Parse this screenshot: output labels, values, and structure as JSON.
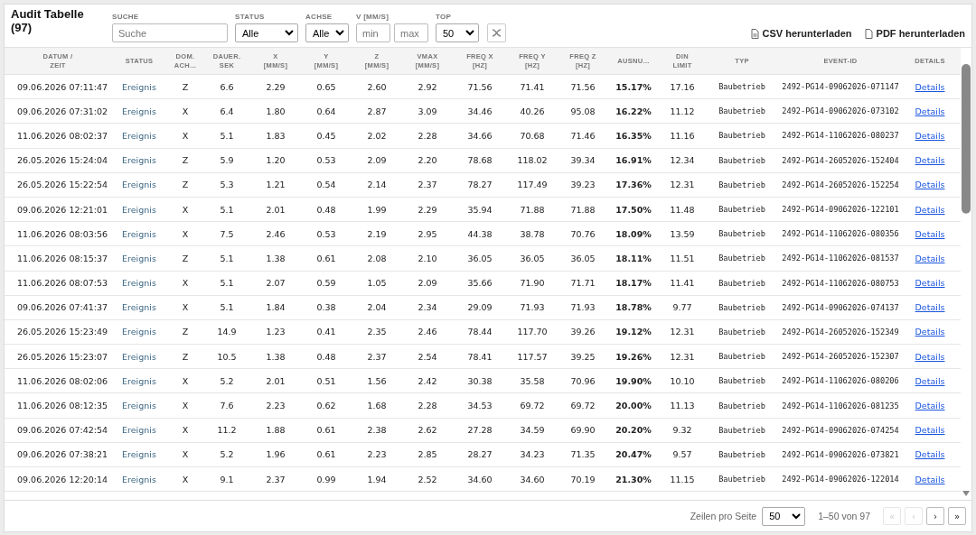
{
  "title": "Audit Tabelle (97)",
  "filters": [
    {
      "kind": "text",
      "label": "SUCHE",
      "placeholder": "Suche"
    },
    {
      "kind": "select",
      "label": "STATUS",
      "value": "Alle"
    },
    {
      "kind": "select",
      "label": "ACHSE",
      "value": "Alle"
    },
    {
      "kind": "range",
      "label": "V [MM/S]",
      "min_placeholder": "min",
      "max_placeholder": "max"
    },
    {
      "kind": "select",
      "label": "TOP",
      "value": "50"
    }
  ],
  "downloads": [
    {
      "kind": "csv",
      "label": "CSV herunterladen"
    },
    {
      "kind": "pdf",
      "label": "PDF herunterladen"
    }
  ],
  "table": {
    "columns": [
      {
        "lines": [
          "DATUM /",
          "ZEIT"
        ],
        "kind": "date"
      },
      {
        "lines": [
          "STATUS"
        ],
        "kind": "status"
      },
      {
        "lines": [
          "DOM.",
          "ACH..."
        ],
        "kind": "num"
      },
      {
        "lines": [
          "DAUER.",
          "SEK"
        ],
        "kind": "num"
      },
      {
        "lines": [
          "X",
          "[MM/S]"
        ],
        "kind": "num"
      },
      {
        "lines": [
          "Y",
          "[MM/S]"
        ],
        "kind": "num"
      },
      {
        "lines": [
          "Z",
          "[MM/S]"
        ],
        "kind": "num"
      },
      {
        "lines": [
          "VMAX",
          "[MM/S]"
        ],
        "kind": "num"
      },
      {
        "lines": [
          "FREQ X",
          "[HZ]"
        ],
        "kind": "num"
      },
      {
        "lines": [
          "FREQ Y",
          "[HZ]"
        ],
        "kind": "num"
      },
      {
        "lines": [
          "FREQ Z",
          "[HZ]"
        ],
        "kind": "num"
      },
      {
        "lines": [
          "AUSNU..."
        ],
        "kind": "bold"
      },
      {
        "lines": [
          "DIN",
          "LIMIT"
        ],
        "kind": "num"
      },
      {
        "lines": [
          "TYP"
        ],
        "kind": "mono"
      },
      {
        "lines": [
          "EVENT-ID"
        ],
        "kind": "mono"
      },
      {
        "lines": [
          "DETAILS"
        ],
        "kind": "link"
      }
    ],
    "rows": [
      [
        "09.06.2026 07:11:47",
        "Ereignis",
        "Z",
        "6.6",
        "2.29",
        "0.65",
        "2.60",
        "2.92",
        "71.56",
        "71.41",
        "71.56",
        "15.17%",
        "17.16",
        "Baubetrieb",
        "2492-PG14-09062026-071147",
        "Details"
      ],
      [
        "09.06.2026 07:31:02",
        "Ereignis",
        "X",
        "6.4",
        "1.80",
        "0.64",
        "2.87",
        "3.09",
        "34.46",
        "40.26",
        "95.08",
        "16.22%",
        "11.12",
        "Baubetrieb",
        "2492-PG14-09062026-073102",
        "Details"
      ],
      [
        "11.06.2026 08:02:37",
        "Ereignis",
        "X",
        "5.1",
        "1.83",
        "0.45",
        "2.02",
        "2.28",
        "34.66",
        "70.68",
        "71.46",
        "16.35%",
        "11.16",
        "Baubetrieb",
        "2492-PG14-11062026-080237",
        "Details"
      ],
      [
        "26.05.2026 15:24:04",
        "Ereignis",
        "Z",
        "5.9",
        "1.20",
        "0.53",
        "2.09",
        "2.20",
        "78.68",
        "118.02",
        "39.34",
        "16.91%",
        "12.34",
        "Baubetrieb",
        "2492-PG14-26052026-152404",
        "Details"
      ],
      [
        "26.05.2026 15:22:54",
        "Ereignis",
        "Z",
        "5.3",
        "1.21",
        "0.54",
        "2.14",
        "2.37",
        "78.27",
        "117.49",
        "39.23",
        "17.36%",
        "12.31",
        "Baubetrieb",
        "2492-PG14-26052026-152254",
        "Details"
      ],
      [
        "09.06.2026 12:21:01",
        "Ereignis",
        "X",
        "5.1",
        "2.01",
        "0.48",
        "1.99",
        "2.29",
        "35.94",
        "71.88",
        "71.88",
        "17.50%",
        "11.48",
        "Baubetrieb",
        "2492-PG14-09062026-122101",
        "Details"
      ],
      [
        "11.06.2026 08:03:56",
        "Ereignis",
        "X",
        "7.5",
        "2.46",
        "0.53",
        "2.19",
        "2.95",
        "44.38",
        "38.78",
        "70.76",
        "18.09%",
        "13.59",
        "Baubetrieb",
        "2492-PG14-11062026-080356",
        "Details"
      ],
      [
        "11.06.2026 08:15:37",
        "Ereignis",
        "Z",
        "5.1",
        "1.38",
        "0.61",
        "2.08",
        "2.10",
        "36.05",
        "36.05",
        "36.05",
        "18.11%",
        "11.51",
        "Baubetrieb",
        "2492-PG14-11062026-081537",
        "Details"
      ],
      [
        "11.06.2026 08:07:53",
        "Ereignis",
        "X",
        "5.1",
        "2.07",
        "0.59",
        "1.05",
        "2.09",
        "35.66",
        "71.90",
        "71.71",
        "18.17%",
        "11.41",
        "Baubetrieb",
        "2492-PG14-11062026-080753",
        "Details"
      ],
      [
        "09.06.2026 07:41:37",
        "Ereignis",
        "X",
        "5.1",
        "1.84",
        "0.38",
        "2.04",
        "2.34",
        "29.09",
        "71.93",
        "71.93",
        "18.78%",
        "9.77",
        "Baubetrieb",
        "2492-PG14-09062026-074137",
        "Details"
      ],
      [
        "26.05.2026 15:23:49",
        "Ereignis",
        "Z",
        "14.9",
        "1.23",
        "0.41",
        "2.35",
        "2.46",
        "78.44",
        "117.70",
        "39.26",
        "19.12%",
        "12.31",
        "Baubetrieb",
        "2492-PG14-26052026-152349",
        "Details"
      ],
      [
        "26.05.2026 15:23:07",
        "Ereignis",
        "Z",
        "10.5",
        "1.38",
        "0.48",
        "2.37",
        "2.54",
        "78.41",
        "117.57",
        "39.25",
        "19.26%",
        "12.31",
        "Baubetrieb",
        "2492-PG14-26052026-152307",
        "Details"
      ],
      [
        "11.06.2026 08:02:06",
        "Ereignis",
        "X",
        "5.2",
        "2.01",
        "0.51",
        "1.56",
        "2.42",
        "30.38",
        "35.58",
        "70.96",
        "19.90%",
        "10.10",
        "Baubetrieb",
        "2492-PG14-11062026-080206",
        "Details"
      ],
      [
        "11.06.2026 08:12:35",
        "Ereignis",
        "X",
        "7.6",
        "2.23",
        "0.62",
        "1.68",
        "2.28",
        "34.53",
        "69.72",
        "69.72",
        "20.00%",
        "11.13",
        "Baubetrieb",
        "2492-PG14-11062026-081235",
        "Details"
      ],
      [
        "09.06.2026 07:42:54",
        "Ereignis",
        "X",
        "11.2",
        "1.88",
        "0.61",
        "2.38",
        "2.62",
        "27.28",
        "34.59",
        "69.90",
        "20.20%",
        "9.32",
        "Baubetrieb",
        "2492-PG14-09062026-074254",
        "Details"
      ],
      [
        "09.06.2026 07:38:21",
        "Ereignis",
        "X",
        "5.2",
        "1.96",
        "0.61",
        "2.23",
        "2.85",
        "28.27",
        "34.23",
        "71.35",
        "20.47%",
        "9.57",
        "Baubetrieb",
        "2492-PG14-09062026-073821",
        "Details"
      ],
      [
        "09.06.2026 12:20:14",
        "Ereignis",
        "X",
        "9.1",
        "2.37",
        "0.99",
        "1.94",
        "2.52",
        "34.60",
        "34.60",
        "70.19",
        "21.30%",
        "11.15",
        "Baubetrieb",
        "2492-PG14-09062026-122014",
        "Details"
      ]
    ]
  },
  "pagination": {
    "rows_label": "Zeilen pro Seite",
    "rows_value": "50",
    "range": "1–50 von 97",
    "buttons": [
      {
        "label": "«",
        "disabled": true
      },
      {
        "label": "‹",
        "disabled": true
      },
      {
        "label": "›",
        "disabled": false
      },
      {
        "label": "»",
        "disabled": false
      }
    ]
  }
}
